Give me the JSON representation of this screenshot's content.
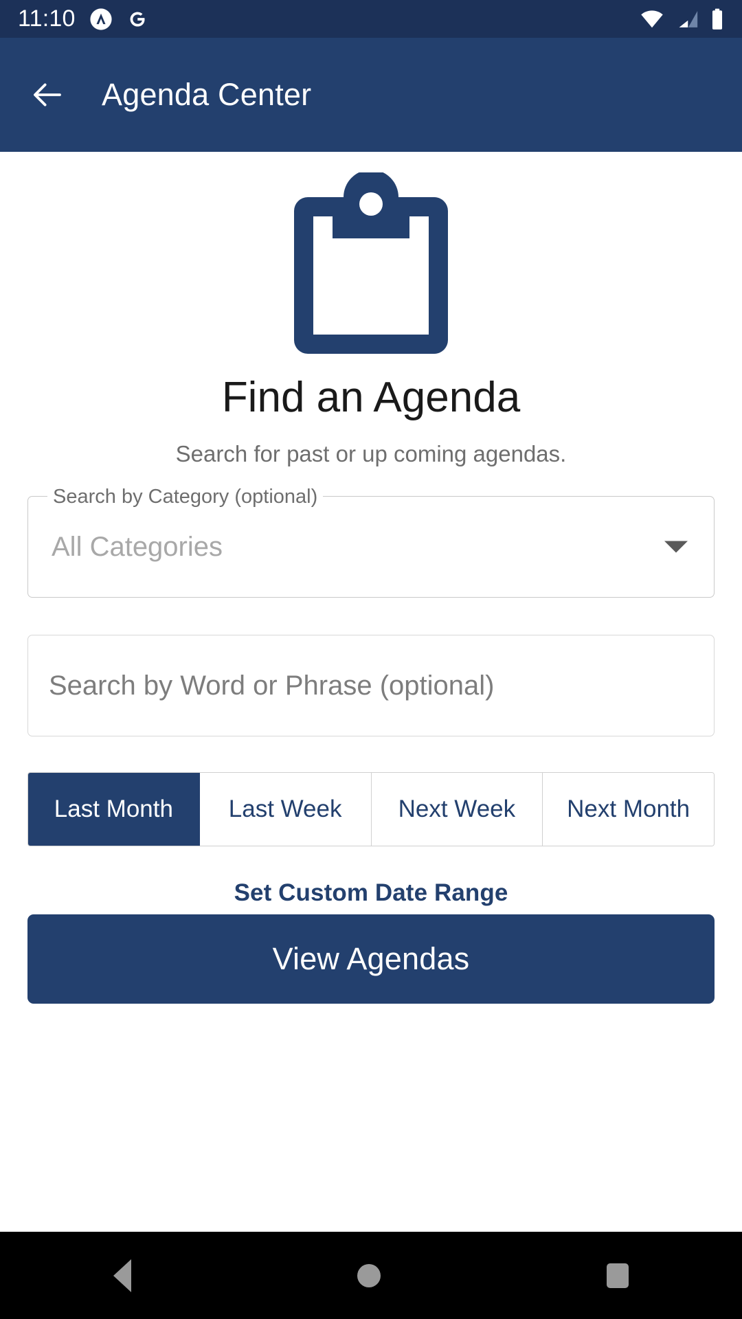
{
  "status_bar": {
    "time": "11:10",
    "icons": [
      {
        "name": "app-notification-icon",
        "glyph": "caret-in-circle"
      },
      {
        "name": "google-icon",
        "glyph": "G"
      },
      {
        "name": "wifi-icon",
        "glyph": "wifi-full"
      },
      {
        "name": "cellular-signal-icon",
        "glyph": "signal-2-of-4"
      },
      {
        "name": "battery-icon",
        "glyph": "battery-full"
      }
    ],
    "background_color": "#1c3158"
  },
  "app_bar": {
    "title": "Agenda Center",
    "back_label": "Back",
    "background_color": "#23406e",
    "text_color": "#ffffff"
  },
  "hero": {
    "illustration": "clipboard-icon",
    "title": "Find an Agenda",
    "subtitle": "Search for past or up coming agendas.",
    "illustration_color": "#23406e"
  },
  "category_field": {
    "label": "Search by Category (optional)",
    "value": "All Categories",
    "dropdown_icon": "chevron-down-icon",
    "options": [
      "All Categories"
    ]
  },
  "keyword_field": {
    "placeholder": "Search by Word or Phrase (optional)",
    "value": ""
  },
  "date_range": {
    "options": [
      {
        "label": "Last Month",
        "selected": true
      },
      {
        "label": "Last Week",
        "selected": false
      },
      {
        "label": "Next Week",
        "selected": false
      },
      {
        "label": "Next Month",
        "selected": false
      }
    ],
    "custom_link": "Set Custom Date Range",
    "active_color": "#23406e"
  },
  "primary_action": {
    "label": "View Agendas",
    "background_color": "#23406e",
    "text_color": "#ffffff"
  },
  "nav_bar": {
    "items": [
      {
        "name": "android-back-button",
        "glyph": "triangle-left"
      },
      {
        "name": "android-home-button",
        "glyph": "circle"
      },
      {
        "name": "android-recents-button",
        "glyph": "square"
      }
    ],
    "background_color": "#000000",
    "icon_color": "#9a9a9a"
  }
}
